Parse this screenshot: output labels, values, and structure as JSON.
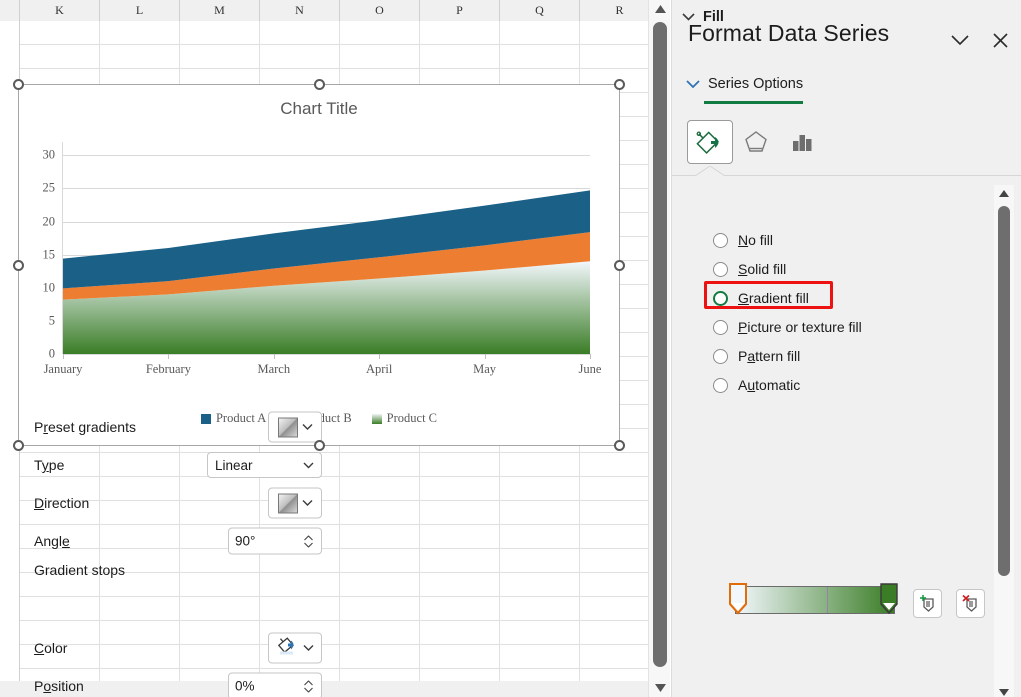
{
  "spreadsheet": {
    "columns": [
      "K",
      "L",
      "M",
      "N",
      "O",
      "P",
      "Q",
      "R"
    ]
  },
  "chart": {
    "title": "Chart Title",
    "handle_name": "selection-handle"
  },
  "chart_data": {
    "type": "area",
    "title": "Chart Title",
    "xlabel": "",
    "ylabel": "",
    "categories": [
      "January",
      "February",
      "March",
      "April",
      "May",
      "June"
    ],
    "yticks": [
      0,
      5,
      10,
      15,
      20,
      25,
      30
    ],
    "ylim": [
      0,
      32
    ],
    "grid": true,
    "legend": "bottom",
    "stacked": true,
    "series": [
      {
        "name": "Product A",
        "color": "#1A6087",
        "values": [
          4.5,
          5.0,
          5.3,
          5.6,
          6.0,
          6.3
        ]
      },
      {
        "name": "Product B",
        "color": "#ED7D31",
        "values": [
          1.7,
          2.0,
          2.6,
          3.2,
          3.8,
          4.4
        ]
      },
      {
        "name": "Product C",
        "color": "#4E9A35",
        "values": [
          8.2,
          9.0,
          10.3,
          11.4,
          12.6,
          14.0
        ]
      }
    ],
    "series_totals": [
      14.4,
      16.0,
      18.2,
      20.2,
      22.4,
      24.7
    ]
  },
  "pane": {
    "title": "Format Data Series",
    "collapse_icon": "chevron-down-icon",
    "close_icon": "close-icon",
    "section_label": "Series Options",
    "accent_color": "#107C41",
    "tabs": [
      {
        "name": "fill-and-line",
        "icon": "paint-bucket-icon",
        "active": true
      },
      {
        "name": "effects",
        "icon": "pentagon-icon",
        "active": false
      },
      {
        "name": "series-options",
        "icon": "bar-chart-icon",
        "active": false
      }
    ],
    "fill": {
      "header": "Fill",
      "options": [
        {
          "label": "No fill",
          "accel": "N",
          "selected": false
        },
        {
          "label": "Solid fill",
          "accel": "S",
          "selected": false
        },
        {
          "label": "Gradient fill",
          "accel": "G",
          "selected": true
        },
        {
          "label": "Picture or texture fill",
          "accel": "P",
          "selected": false
        },
        {
          "label": "Pattern fill",
          "accel": "a",
          "selected": false
        },
        {
          "label": "Automatic",
          "accel": "u",
          "selected": false
        }
      ],
      "highlight_color": "#EE1111",
      "controls": {
        "preset_gradients_label": "Preset gradients",
        "preset_gradients_accel": "r",
        "type_label": "Type",
        "type_accel": "y",
        "type_value": "Linear",
        "direction_label": "Direction",
        "direction_accel": "D",
        "angle_label": "Angle",
        "angle_accel": "e",
        "angle_value": "90°",
        "gradient_stops_label": "Gradient stops",
        "add_stop_icon": "add-gradient-stop-icon",
        "remove_stop_icon": "remove-gradient-stop-icon",
        "color_label": "Color",
        "color_accel": "C",
        "color_icon": "fill-color-icon",
        "position_label": "Position",
        "position_accel": "o",
        "position_value": "0%"
      },
      "gradient_stops": [
        {
          "position": "0%",
          "color": "#F2F7FC",
          "selected": true
        },
        {
          "position": "100%",
          "color": "#3A7D26",
          "selected": false
        }
      ]
    }
  }
}
